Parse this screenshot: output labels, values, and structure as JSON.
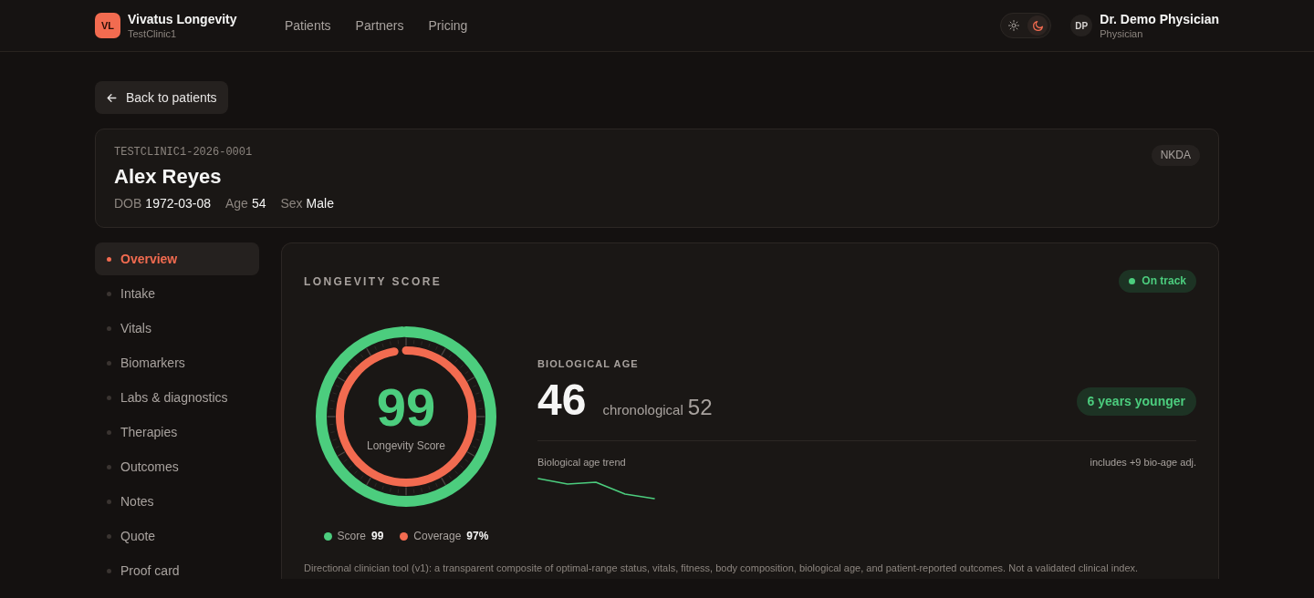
{
  "header": {
    "logo": "VL",
    "brand": "Vivatus Longevity",
    "clinic": "TestClinic1",
    "nav": [
      {
        "label": "Patients"
      },
      {
        "label": "Partners"
      },
      {
        "label": "Pricing"
      }
    ],
    "theme_toggle": [
      {
        "kind": "light",
        "selected": false
      },
      {
        "kind": "dark",
        "selected": true
      }
    ],
    "user": {
      "initials": "DP",
      "name": "Dr. Demo Physician",
      "role": "Physician"
    }
  },
  "back_button": {
    "label": "Back to patients"
  },
  "patient": {
    "id": "TESTCLINIC1-2026-0001",
    "name": "Alex Reyes",
    "fields": [
      {
        "label": "DOB",
        "value": "1972-03-08"
      },
      {
        "label": "Age",
        "value": "54"
      },
      {
        "label": "Sex",
        "value": "Male"
      }
    ],
    "tag": "NKDA"
  },
  "sidebar": {
    "items": [
      {
        "label": "Overview",
        "selected": true
      },
      {
        "label": "Intake",
        "selected": false
      },
      {
        "label": "Vitals",
        "selected": false
      },
      {
        "label": "Biomarkers",
        "selected": false
      },
      {
        "label": "Labs & diagnostics",
        "selected": false
      },
      {
        "label": "Therapies",
        "selected": false
      },
      {
        "label": "Outcomes",
        "selected": false
      },
      {
        "label": "Notes",
        "selected": false
      },
      {
        "label": "Quote",
        "selected": false
      },
      {
        "label": "Proof card",
        "selected": false
      }
    ]
  },
  "score_card": {
    "title": "LONGEVITY SCORE",
    "status": "On track",
    "gauge": {
      "value": "99",
      "caption": "Longevity Score"
    },
    "metrics": [
      {
        "label": "Score",
        "value": "99",
        "level": 0.99,
        "color": "#4ccd7e"
      },
      {
        "label": "Coverage",
        "value": "97%",
        "level": 0.97,
        "color": "#f26b50"
      }
    ],
    "biological_age": {
      "title": "BIOLOGICAL AGE",
      "value": "46",
      "chronological_label": "chronological",
      "chronological_value": "52",
      "difference": "6 years younger",
      "trend_label": "Biological age trend",
      "adjustment_note": "includes +9 bio-age adj."
    },
    "disclaimer": "Directional clinician tool (v1): a transparent composite of optimal-range status, vitals, fitness, body composition, biological age, and patient-reported outcomes. Not a validated clinical index."
  }
}
